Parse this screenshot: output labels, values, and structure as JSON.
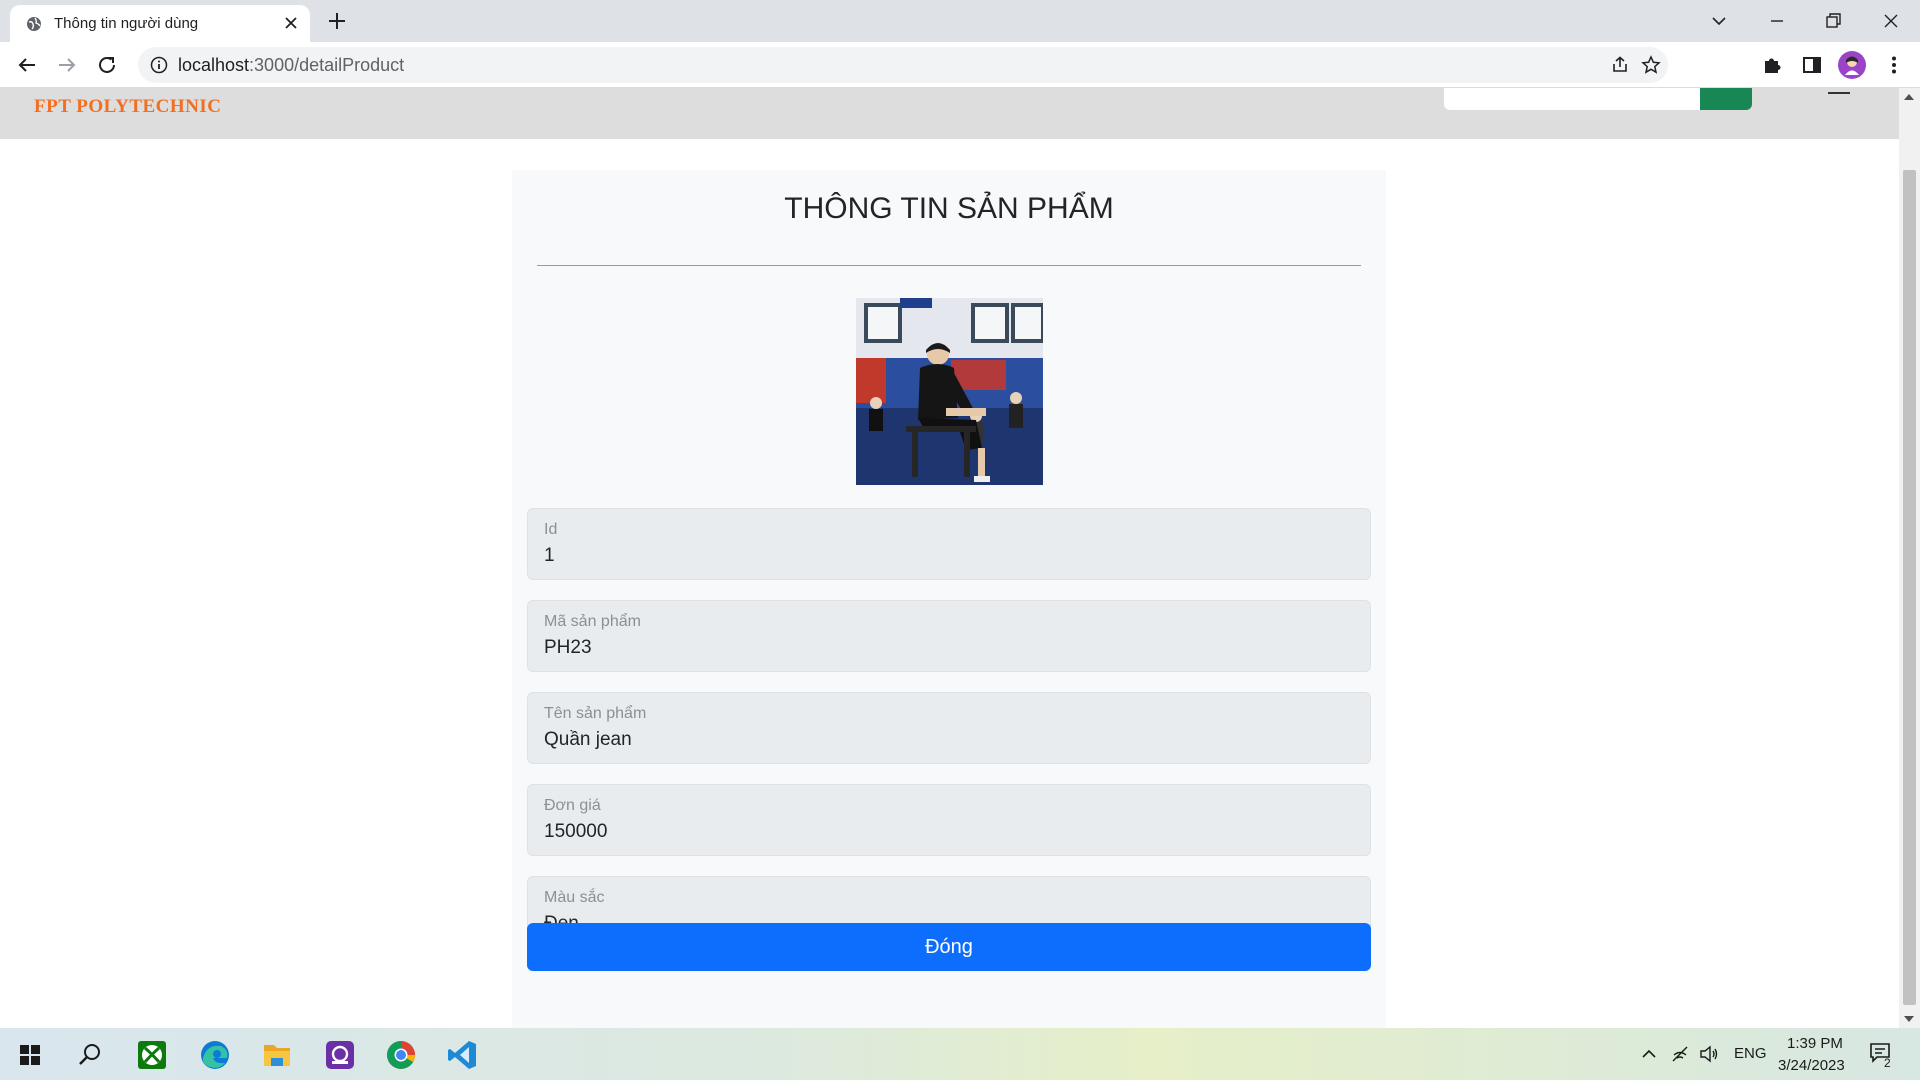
{
  "browser": {
    "tab_title": "Thông tin người dùng",
    "url_host": "localhost",
    "url_path": ":3000/detailProduct",
    "icons": [
      "globe-favicon-icon",
      "close-icon",
      "plus-icon",
      "chevron-down-icon",
      "minimize-icon",
      "restore-icon",
      "window-close-icon",
      "back-arrow-icon",
      "forward-arrow-icon",
      "reload-icon",
      "info-icon",
      "share-icon",
      "star-icon",
      "puzzle-icon",
      "side-panel-icon",
      "kebab-menu-icon"
    ]
  },
  "page": {
    "brand": "FPT POLYTECHNIC",
    "title": "THÔNG TIN SẢN PHẨM",
    "photo_alt": "",
    "fields": [
      {
        "label": "Id",
        "value": "1"
      },
      {
        "label": "Mã sản phẩm",
        "value": "PH23"
      },
      {
        "label": "Tên sản phẩm",
        "value": "Quần jean"
      },
      {
        "label": "Đơn giá",
        "value": "150000"
      },
      {
        "label": "Màu sắc",
        "value": "Đen"
      }
    ],
    "close_button": "Đóng"
  },
  "colors": {
    "brand": "#f26f21",
    "primary": "#0d6efd",
    "search_button": "#198754",
    "navbar": "#dddddd",
    "card": "#f8f9fa",
    "field": "#e9ecef"
  },
  "taskbar": {
    "apps": [
      "windows-start-icon",
      "search-icon",
      "xbox-icon",
      "edge-icon",
      "file-explorer-icon",
      "media-app-icon",
      "chrome-icon",
      "vscode-icon"
    ],
    "language": "ENG",
    "time": "1:39 PM",
    "date": "3/24/2023",
    "notification_count": "2"
  }
}
